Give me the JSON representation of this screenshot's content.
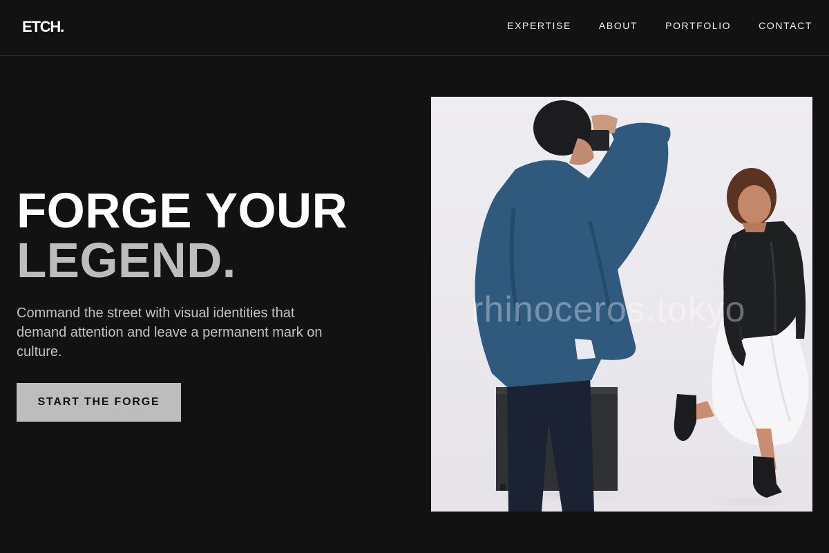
{
  "header": {
    "logo": "ETCH.",
    "nav": [
      "EXPERTISE",
      "ABOUT",
      "PORTFOLIO",
      "CONTACT"
    ]
  },
  "hero": {
    "title_line1": "FORGE YOUR",
    "title_line2": "LEGEND.",
    "subtitle": "Command the street with visual identities that demand attention and leave a permanent mark on culture.",
    "cta_label": "START THE FORGE"
  },
  "photo": {
    "watermark": "rhinoceros.tokyo"
  },
  "colors": {
    "background": "#121212",
    "accent_gray": "#bdbdbd",
    "text_white": "#ffffff"
  }
}
